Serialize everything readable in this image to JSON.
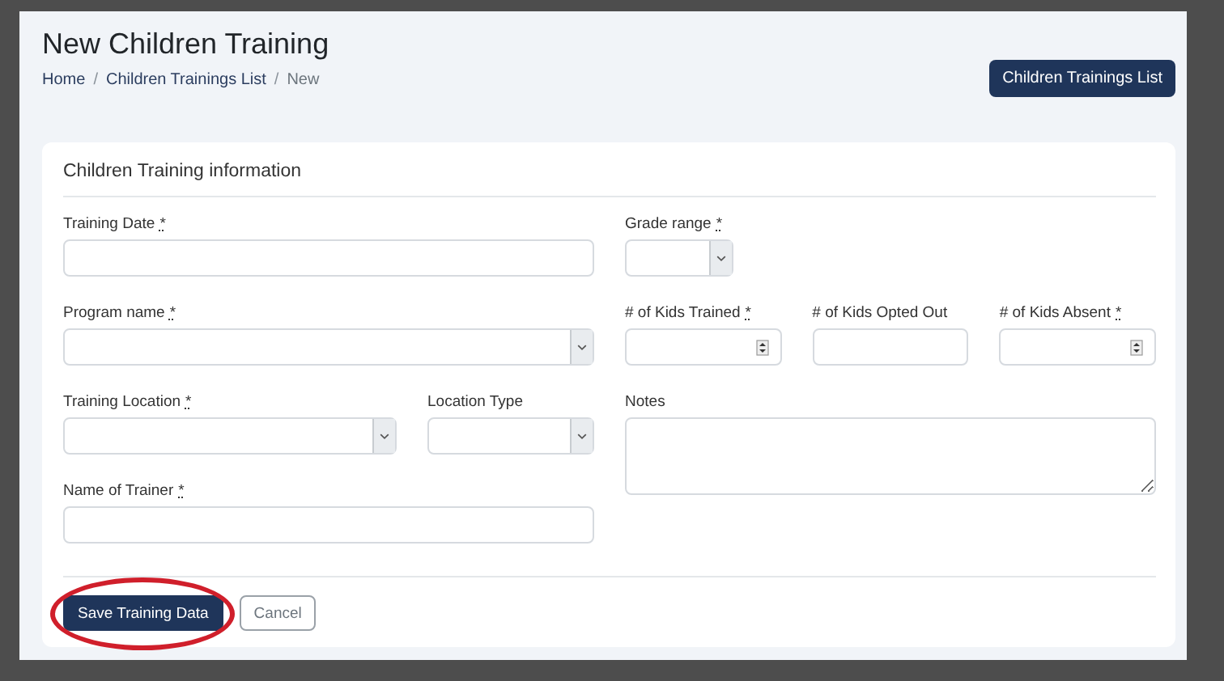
{
  "page": {
    "title": "New Children Training",
    "breadcrumb": [
      {
        "label": "Home",
        "current": false
      },
      {
        "label": "Children Trainings List",
        "current": false
      },
      {
        "label": "New",
        "current": true
      }
    ],
    "separator": "/",
    "action_button": "Children Trainings List"
  },
  "card": {
    "title": "Children Training information",
    "left_rows": [
      [
        {
          "label": "Training Date",
          "required": true,
          "kind": "text"
        }
      ],
      [
        {
          "label": "Program name",
          "required": true,
          "kind": "select"
        }
      ],
      [
        {
          "label": "Training Location",
          "required": true,
          "kind": "select"
        },
        {
          "label": "Location Type",
          "required": false,
          "kind": "select"
        }
      ],
      [
        {
          "label": "Name of Trainer",
          "required": true,
          "kind": "text"
        }
      ]
    ],
    "right_rows": [
      [
        {
          "label": "Grade range",
          "required": true,
          "kind": "select-small"
        }
      ],
      [
        {
          "label": "# of Kids Trained",
          "required": true,
          "kind": "number"
        },
        {
          "label": "# of Kids Opted Out",
          "required": false,
          "kind": "text"
        },
        {
          "label": "# of Kids Absent",
          "required": true,
          "kind": "number"
        }
      ],
      [
        {
          "label": "Notes",
          "required": false,
          "kind": "textarea"
        }
      ]
    ],
    "required_mark": "*",
    "buttons": [
      {
        "label": "Save Training Data",
        "kind": "primary",
        "highlighted": true
      },
      {
        "label": "Cancel",
        "kind": "secondary",
        "highlighted": false
      }
    ]
  }
}
